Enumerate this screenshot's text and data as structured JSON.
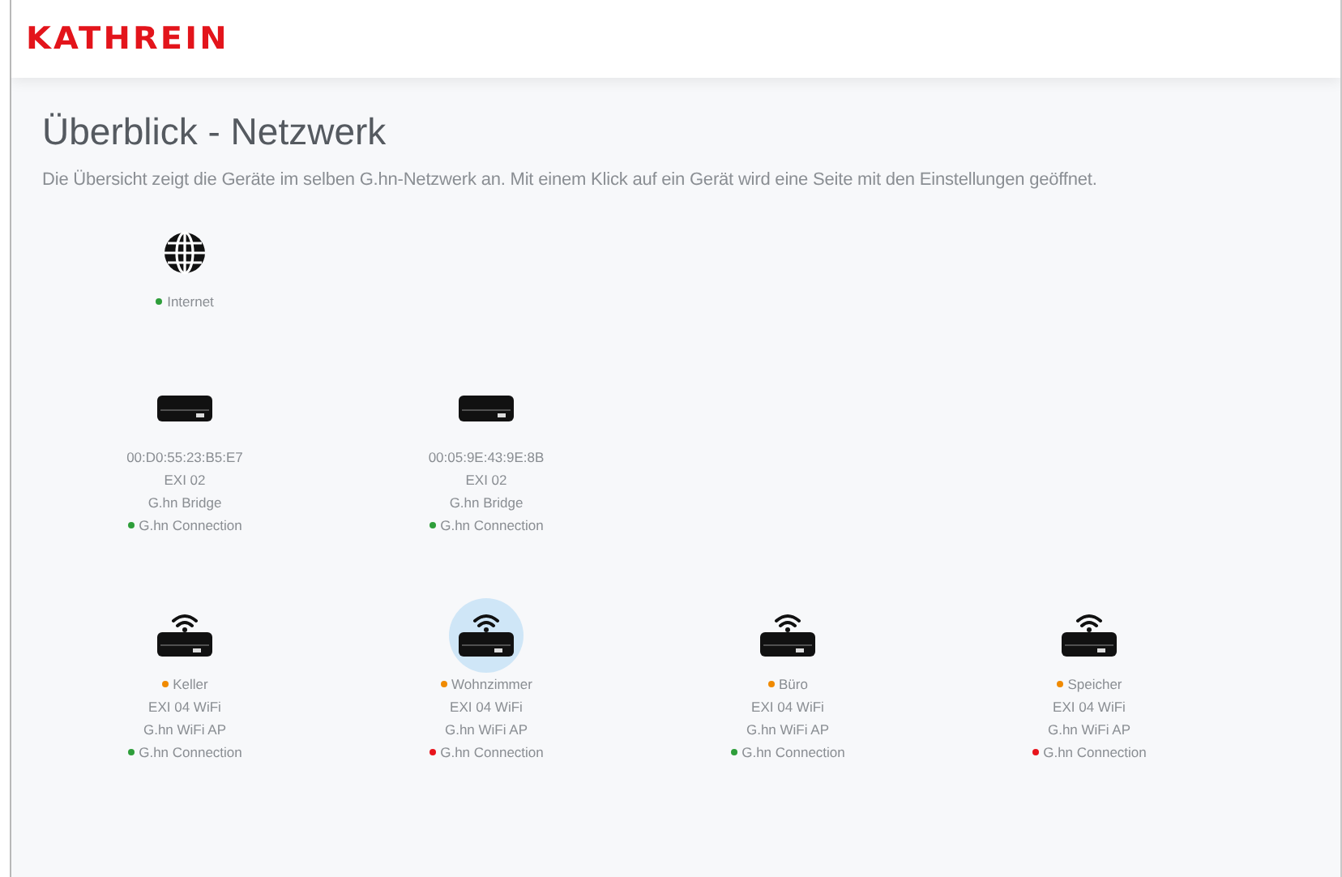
{
  "header": {
    "logo": "KATHREIN"
  },
  "page": {
    "title": "Überblick - Netzwerk",
    "description": "Die Übersicht zeigt die Geräte im selben G.hn-Netzwerk an. Mit einem Klick auf ein Gerät wird eine Seite mit den Einstellungen geöffnet."
  },
  "rows": [
    {
      "devices": [
        {
          "kind": "internet",
          "selected": false,
          "lines": [
            {
              "text": "Internet",
              "color": "#2e9e3a"
            }
          ]
        }
      ]
    },
    {
      "devices": [
        {
          "kind": "bridge",
          "selected": false,
          "lines": [
            {
              "text": "00:D0:55:23:B5:E7"
            },
            {
              "text": "EXI 02"
            },
            {
              "text": "G.hn Bridge"
            },
            {
              "text": "G.hn Connection",
              "color": "#2e9e3a"
            }
          ]
        },
        {
          "kind": "bridge",
          "selected": false,
          "lines": [
            {
              "text": "00:05:9E:43:9E:8B"
            },
            {
              "text": "EXI 02"
            },
            {
              "text": "G.hn Bridge"
            },
            {
              "text": "G.hn Connection",
              "color": "#2e9e3a"
            }
          ]
        }
      ]
    },
    {
      "devices": [
        {
          "kind": "wifi",
          "selected": false,
          "lines": [
            {
              "text": "Keller",
              "color": "#f08a00"
            },
            {
              "text": "EXI 04 WiFi"
            },
            {
              "text": "G.hn WiFi AP"
            },
            {
              "text": "G.hn Connection",
              "color": "#2e9e3a"
            }
          ]
        },
        {
          "kind": "wifi",
          "selected": true,
          "lines": [
            {
              "text": "Wohnzimmer",
              "color": "#f08a00"
            },
            {
              "text": "EXI 04 WiFi"
            },
            {
              "text": "G.hn WiFi AP"
            },
            {
              "text": "G.hn Connection",
              "color": "#e8141c"
            }
          ]
        },
        {
          "kind": "wifi",
          "selected": false,
          "lines": [
            {
              "text": "Büro",
              "color": "#f08a00"
            },
            {
              "text": "EXI 04 WiFi"
            },
            {
              "text": "G.hn WiFi AP"
            },
            {
              "text": "G.hn Connection",
              "color": "#2e9e3a"
            }
          ]
        },
        {
          "kind": "wifi",
          "selected": false,
          "lines": [
            {
              "text": "Speicher",
              "color": "#f08a00"
            },
            {
              "text": "EXI 04 WiFi"
            },
            {
              "text": "G.hn WiFi AP"
            },
            {
              "text": "G.hn Connection",
              "color": "#e8141c"
            }
          ]
        }
      ]
    }
  ]
}
